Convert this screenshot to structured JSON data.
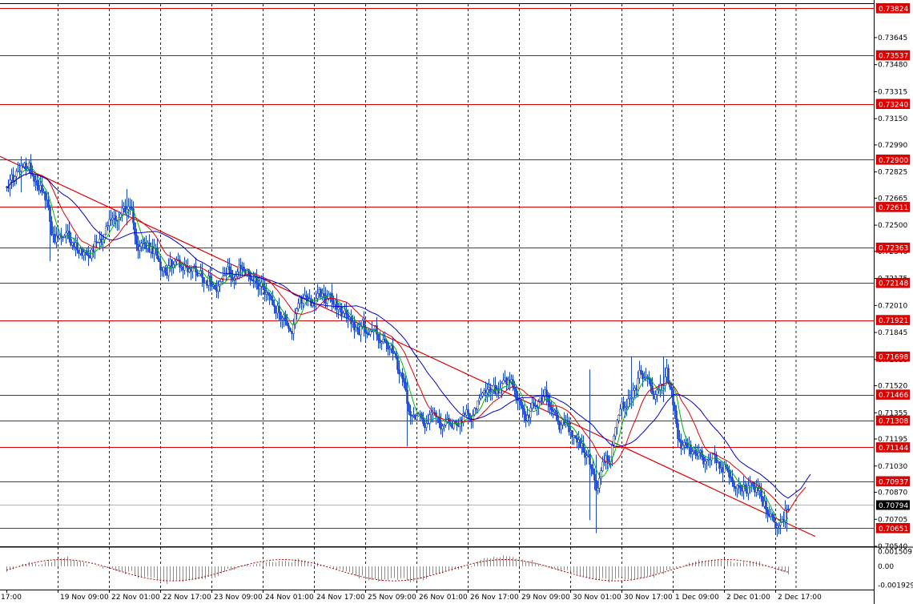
{
  "chart_data": {
    "type": "candlestick",
    "symbol_hint": "",
    "price_axis": {
      "ylim": [
        0.7054,
        0.7385
      ],
      "ticks": [
        "0.73645",
        "0.73480",
        "0.73315",
        "0.73150",
        "0.72990",
        "0.72825",
        "0.72665",
        "0.72500",
        "0.72340",
        "0.72175",
        "0.72010",
        "0.71845",
        "0.71680",
        "0.71520",
        "0.71355",
        "0.71195",
        "0.71030",
        "0.70870",
        "0.70705",
        "0.70540"
      ],
      "tick_values": [
        0.73645,
        0.7348,
        0.73315,
        0.7315,
        0.7299,
        0.72825,
        0.72665,
        0.725,
        0.7234,
        0.72175,
        0.7201,
        0.71845,
        0.7168,
        0.7152,
        0.71355,
        0.71195,
        0.7103,
        0.7087,
        0.70705,
        0.7054
      ]
    },
    "levels": [
      {
        "label": "0.73824",
        "value": 0.73824
      },
      {
        "label": "0.73537",
        "value": 0.73537
      },
      {
        "label": "0.73240",
        "value": 0.7324
      },
      {
        "label": "0.72900",
        "value": 0.729
      },
      {
        "label": "0.72611",
        "value": 0.72611
      },
      {
        "label": "0.72363",
        "value": 0.72363
      },
      {
        "label": "0.72148",
        "value": 0.72148
      },
      {
        "label": "0.71921",
        "value": 0.71921
      },
      {
        "label": "0.71698",
        "value": 0.71698
      },
      {
        "label": "0.71466",
        "value": 0.71466
      },
      {
        "label": "0.71308",
        "value": 0.71308
      },
      {
        "label": "0.71144",
        "value": 0.71144
      },
      {
        "label": "0.70937",
        "value": 0.70937
      },
      {
        "label": "0.70651",
        "value": 0.70651
      }
    ],
    "current_price": {
      "label": "0.70794",
      "value": 0.70794
    },
    "time_axis": {
      "labels": [
        "17:00",
        "19 Nov 09:00",
        "22 Nov 01:00",
        "22 Nov 17:00",
        "23 Nov 09:00",
        "24 Nov 01:00",
        "24 Nov 17:00",
        "25 Nov 09:00",
        "26 Nov 01:00",
        "26 Nov 17:00",
        "29 Nov 09:00",
        "30 Nov 01:00",
        "30 Nov 17:00",
        "1 Dec 09:00",
        "2 Dec 01:00",
        "2 Dec 17:00"
      ],
      "bar_index": [
        0,
        32,
        64,
        96,
        128,
        160,
        192,
        224,
        256,
        288,
        320,
        352,
        384,
        416,
        448,
        480
      ],
      "total_bars": 495
    },
    "candle_path": [
      [
        0,
        0.7278
      ],
      [
        14,
        0.7283
      ],
      [
        22,
        0.7278
      ],
      [
        30,
        0.724
      ],
      [
        48,
        0.7236
      ],
      [
        62,
        0.725
      ],
      [
        74,
        0.7262
      ],
      [
        82,
        0.724
      ],
      [
        96,
        0.7228
      ],
      [
        112,
        0.7226
      ],
      [
        130,
        0.722
      ],
      [
        148,
        0.7222
      ],
      [
        160,
        0.7216
      ],
      [
        170,
        0.72
      ],
      [
        178,
        0.719
      ],
      [
        186,
        0.7205
      ],
      [
        200,
        0.7205
      ],
      [
        214,
        0.719
      ],
      [
        230,
        0.7188
      ],
      [
        240,
        0.717
      ],
      [
        250,
        0.7142
      ],
      [
        262,
        0.7135
      ],
      [
        275,
        0.7128
      ],
      [
        290,
        0.7138
      ],
      [
        302,
        0.7143
      ],
      [
        315,
        0.7145
      ],
      [
        325,
        0.713
      ],
      [
        336,
        0.7148
      ],
      [
        344,
        0.7133
      ],
      [
        352,
        0.712
      ],
      [
        362,
        0.711
      ],
      [
        368,
        0.709
      ],
      [
        374,
        0.7105
      ],
      [
        384,
        0.7132
      ],
      [
        396,
        0.716
      ],
      [
        406,
        0.7148
      ],
      [
        412,
        0.716
      ],
      [
        420,
        0.7118
      ],
      [
        432,
        0.7103
      ],
      [
        440,
        0.711
      ],
      [
        452,
        0.71
      ],
      [
        465,
        0.709
      ],
      [
        475,
        0.7075
      ],
      [
        482,
        0.707
      ],
      [
        488,
        0.7082
      ]
    ],
    "spikes": [
      {
        "bar": 9,
        "high": 0.7292,
        "low": 0.727
      },
      {
        "bar": 27,
        "high": 0.7245,
        "low": 0.7228
      },
      {
        "bar": 75,
        "high": 0.7272,
        "low": 0.725
      },
      {
        "bar": 250,
        "high": 0.7145,
        "low": 0.7115
      },
      {
        "bar": 364,
        "high": 0.7162,
        "low": 0.707
      },
      {
        "bar": 368,
        "high": 0.711,
        "low": 0.7062
      },
      {
        "bar": 390,
        "high": 0.717,
        "low": 0.7138
      },
      {
        "bar": 410,
        "high": 0.717,
        "low": 0.7142
      },
      {
        "bar": 487,
        "high": 0.7078,
        "low": 0.7063
      }
    ],
    "moving_averages": [
      {
        "color": "#00b300",
        "period": 8
      },
      {
        "color": "#e00000",
        "period": 20
      },
      {
        "color": "#0000cc",
        "period": 40
      }
    ],
    "trendline": {
      "from": [
        -15,
        0.7297
      ],
      "to": [
        505,
        0.706
      ],
      "color": "#e00000"
    },
    "oscillator": {
      "ticks": [
        "0.001509",
        "0.00",
        "-0.001929"
      ],
      "tick_values": [
        0.001509,
        0,
        -0.001929
      ],
      "ylim": [
        -0.0024,
        0.0019
      ]
    },
    "colors": {
      "candle": "#1a46c8",
      "level_line": "#e00000",
      "label_box": "#e00000",
      "label_text": "#ffffff",
      "grid": "#000000",
      "current_box": "#000000",
      "osc_up": "#8c8c8c",
      "osc_down": "#b00000"
    }
  }
}
